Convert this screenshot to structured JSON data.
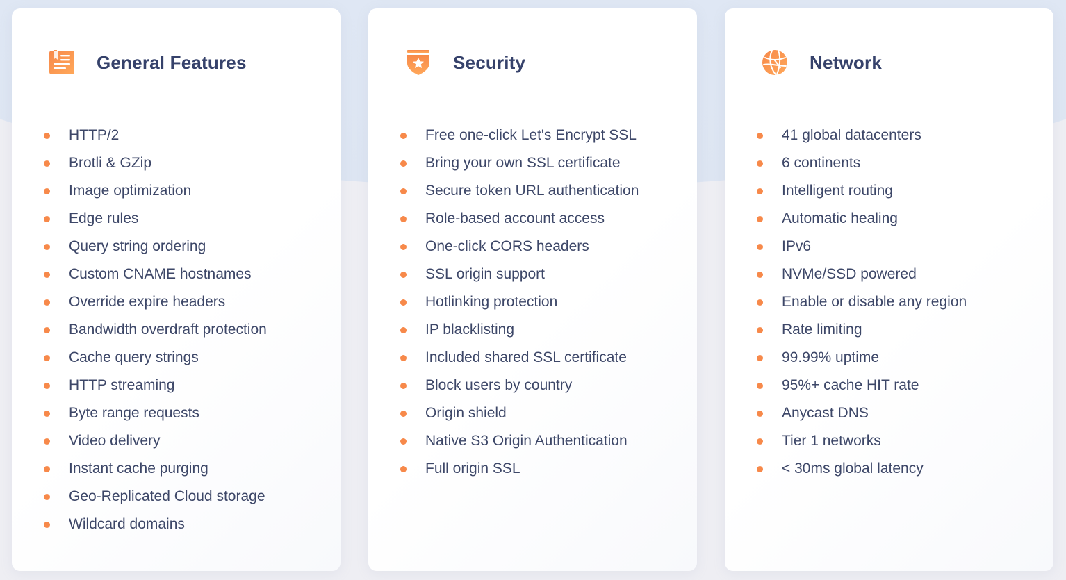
{
  "colors": {
    "accent": "#f7894a",
    "accent_light": "#ffa25a",
    "title": "#36426b",
    "text": "#3d4768",
    "background_top": "#e4ecf8",
    "background_bottom": "#eeeef3",
    "card": "#ffffff"
  },
  "cards": [
    {
      "title": "General Features",
      "icon": "document-list-icon",
      "items": [
        "HTTP/2",
        "Brotli & GZip",
        "Image optimization",
        "Edge rules",
        "Query string ordering",
        "Custom CNAME hostnames",
        "Override expire headers",
        "Bandwidth overdraft protection",
        "Cache query strings",
        "HTTP streaming",
        "Byte range requests",
        "Video delivery",
        "Instant cache purging",
        "Geo-Replicated Cloud storage",
        "Wildcard domains"
      ]
    },
    {
      "title": "Security",
      "icon": "shield-star-icon",
      "items": [
        "Free one-click Let's Encrypt SSL",
        "Bring your own SSL certificate",
        "Secure token URL authentication",
        "Role-based account access",
        "One-click CORS headers",
        "SSL origin support",
        "Hotlinking protection",
        "IP blacklisting",
        "Included shared SSL certificate",
        "Block users by country",
        "Origin shield",
        "Native S3 Origin Authentication",
        "Full origin SSL"
      ]
    },
    {
      "title": "Network",
      "icon": "globe-network-icon",
      "items": [
        "41 global datacenters",
        "6 continents",
        "Intelligent routing",
        "Automatic healing",
        "IPv6",
        "NVMe/SSD powered",
        "Enable or disable any region",
        "Rate limiting",
        "99.99% uptime",
        "95%+ cache HIT rate",
        "Anycast DNS",
        "Tier 1 networks",
        "< 30ms global latency"
      ]
    }
  ]
}
